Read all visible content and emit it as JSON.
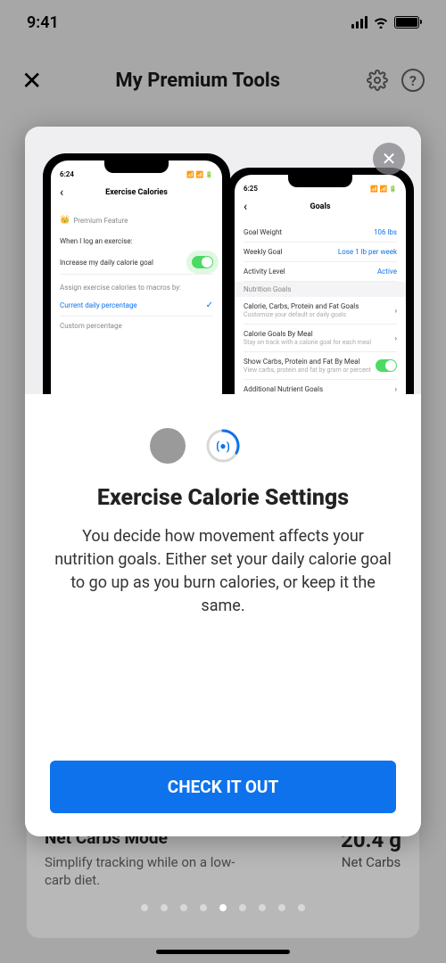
{
  "status": {
    "time": "9:41"
  },
  "header": {
    "title": "My Premium Tools"
  },
  "modal": {
    "title": "Exercise Calorie Settings",
    "description": "You decide how movement affects your nutrition goals. Either set your daily calorie goal to go up as you burn calories, or keep it the same.",
    "cta": "CHECK IT OUT",
    "phone1": {
      "time": "6:24",
      "title": "Exercise Calories",
      "premium": "Premium Feature",
      "prompt": "When I log an exercise:",
      "increase": "Increase my daily calorie goal",
      "assign": "Assign exercise calories to macros by:",
      "opt1": "Current daily percentage",
      "opt2": "Custom percentage"
    },
    "phone2": {
      "time": "6:25",
      "title": "Goals",
      "gw": "Goal Weight",
      "gwv": "106 lbs",
      "wg": "Weekly Goal",
      "wgv": "Lose 1 lb per week",
      "al": "Activity Level",
      "alv": "Active",
      "ng": "Nutrition Goals",
      "r1": "Calorie, Carbs, Protein and Fat Goals",
      "r1s": "Customize your default or daily goals",
      "r2": "Calorie Goals By Meal",
      "r2s": "Stay on track with a calorie goal for each meal",
      "r3": "Show Carbs, Protein and Fat By Meal",
      "r3s": "View carbs, protein and fat by gram or percent",
      "r4": "Additional Nutrient Goals"
    }
  },
  "bottom": {
    "title": "Net Carbs Mode",
    "sub": "Simplify tracking while on a low-carb diet.",
    "val": "20.4 g",
    "lbl": "Net Carbs"
  }
}
